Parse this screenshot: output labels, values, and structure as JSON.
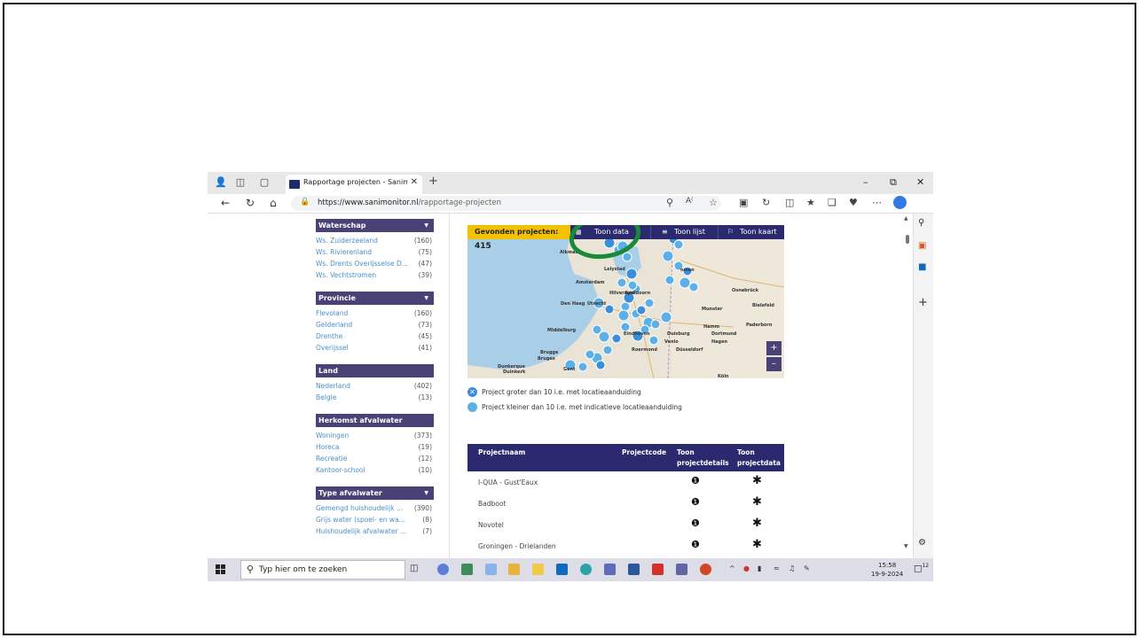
{
  "browser": {
    "tab_title": "Rapportage projecten - Sanimonitor",
    "url_host": "https://www.sanimonitor.nl",
    "url_path": "/rapportage-projecten"
  },
  "filters": [
    {
      "title": "Waterschap",
      "items": [
        {
          "name": "Ws. Zuiderzeeland",
          "count": "(160)"
        },
        {
          "name": "Ws. Rivierenland",
          "count": "(75)"
        },
        {
          "name": "Ws. Drents Overijsselse D...",
          "count": "(47)"
        },
        {
          "name": "Ws. Vechtstromen",
          "count": "(39)"
        }
      ]
    },
    {
      "title": "Provincie",
      "items": [
        {
          "name": "Flevoland",
          "count": "(160)"
        },
        {
          "name": "Gelderland",
          "count": "(73)"
        },
        {
          "name": "Drenthe",
          "count": "(45)"
        },
        {
          "name": "Overijssel",
          "count": "(41)"
        }
      ]
    },
    {
      "title": "Land",
      "items": [
        {
          "name": "Nederland",
          "count": "(402)"
        },
        {
          "name": "Belgie",
          "count": "(13)"
        }
      ]
    },
    {
      "title": "Herkomst afvalwater",
      "items": [
        {
          "name": "Woningen",
          "count": "(373)"
        },
        {
          "name": "Horeca",
          "count": "(19)"
        },
        {
          "name": "Recreatie",
          "count": "(12)"
        },
        {
          "name": "Kantoor-school",
          "count": "(10)"
        }
      ]
    },
    {
      "title": "Type afvalwater",
      "items": [
        {
          "name": "Gemengd huishoudelijk ...",
          "count": "(390)"
        },
        {
          "name": "Grijs water (spoel- en wa...",
          "count": "(8)"
        },
        {
          "name": "Huishoudelijk afvalwater ...",
          "count": "(7)"
        }
      ]
    }
  ],
  "toolbar": {
    "found_label": "Gevonden projecten:",
    "found_count": "415",
    "toon_data": "Toon data",
    "toon_lijst": "Toon lijst",
    "toon_kaart": "Toon kaart"
  },
  "map_labels": [
    "Alkmaar",
    "Lelystad",
    "Amsterdam",
    "Hilversum",
    "Apeldoorn",
    "Den Haag",
    "Utrecht",
    "Munster",
    "Bielefeld",
    "Osnabrück",
    "Hamm",
    "Paderborn",
    "Middelburg",
    "Eindhoven",
    "Duisburg",
    "Dortmund",
    "Düsseldorf",
    "Roermond",
    "Venlo",
    "Hagen",
    "Brugge",
    "Bruges",
    "Dunkerque",
    "Duinkerk",
    "Gent",
    "Köln",
    "nmen"
  ],
  "legend": {
    "large": "Project groter dan 10 i.e. met locatieaanduiding",
    "small": "Project kleiner dan 10 i.e. met indicatieve locatieaanduiding"
  },
  "table": {
    "col_name": "Projectnaam",
    "col_code": "Projectcode",
    "col_details_1": "Toon",
    "col_details_2": "projectdetails",
    "col_data_1": "Toon",
    "col_data_2": "projectdata",
    "rows": [
      {
        "name": "I-QUA - Gust'Eaux"
      },
      {
        "name": "Badboot"
      },
      {
        "name": "Novotel"
      },
      {
        "name": "Groningen - Drielanden"
      }
    ]
  },
  "taskbar": {
    "search_placeholder": "Typ hier om te zoeken",
    "time": "15:58",
    "date": "19-9-2024",
    "notifications": "12"
  },
  "colors": {
    "header_purple": "#4a4277",
    "toolbar_navy": "#2c2a6e",
    "found_yellow": "#f2c200",
    "link_blue": "#4a90c9",
    "marker_blue": "#5cb0e8",
    "annotation_green": "#1a8a3a"
  }
}
